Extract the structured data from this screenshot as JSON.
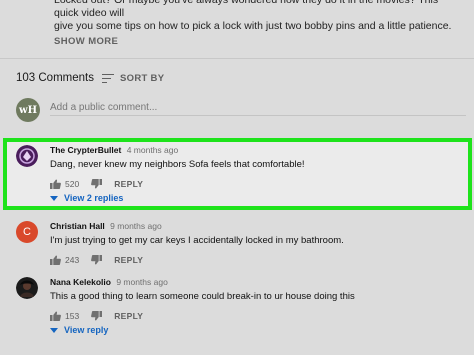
{
  "video": {
    "description_lines": [
      "Locked out? Or maybe you've always wondered how they do it in the movies? This quick video will",
      "give you some tips on how to pick a lock with just two bobby pins and a little patience."
    ],
    "show_more_label": "SHOW MORE"
  },
  "comments_header": {
    "count_label": "103 Comments",
    "sort_label": "SORT BY"
  },
  "add_comment": {
    "avatar_text": "wH",
    "placeholder": "Add a public comment..."
  },
  "comments": [
    {
      "author": "The CrypterBullet",
      "time": "4 months ago",
      "text": "Dang, never knew my neighbors Sofa feels that comfortable!",
      "likes": "520",
      "reply_label": "REPLY",
      "replies_label": "View 2 replies",
      "avatar_color": "#4a1d5c"
    },
    {
      "author": "Christian Hall",
      "time": "9 months ago",
      "text": "I'm just trying to get my car keys I accidentally locked in my bathroom.",
      "likes": "243",
      "reply_label": "REPLY",
      "avatar_letter": "C",
      "avatar_color": "#d9492b"
    },
    {
      "author": "Nana Kelekolio",
      "time": "9 months ago",
      "text": "This a good thing to learn someone could break-in to ur house doing this",
      "likes": "153",
      "reply_label": "REPLY",
      "replies_label": "View reply",
      "avatar_color": "#1b1b1b"
    }
  ],
  "colors": {
    "highlight_border": "#1ee31b",
    "link_blue": "#1565c0"
  }
}
